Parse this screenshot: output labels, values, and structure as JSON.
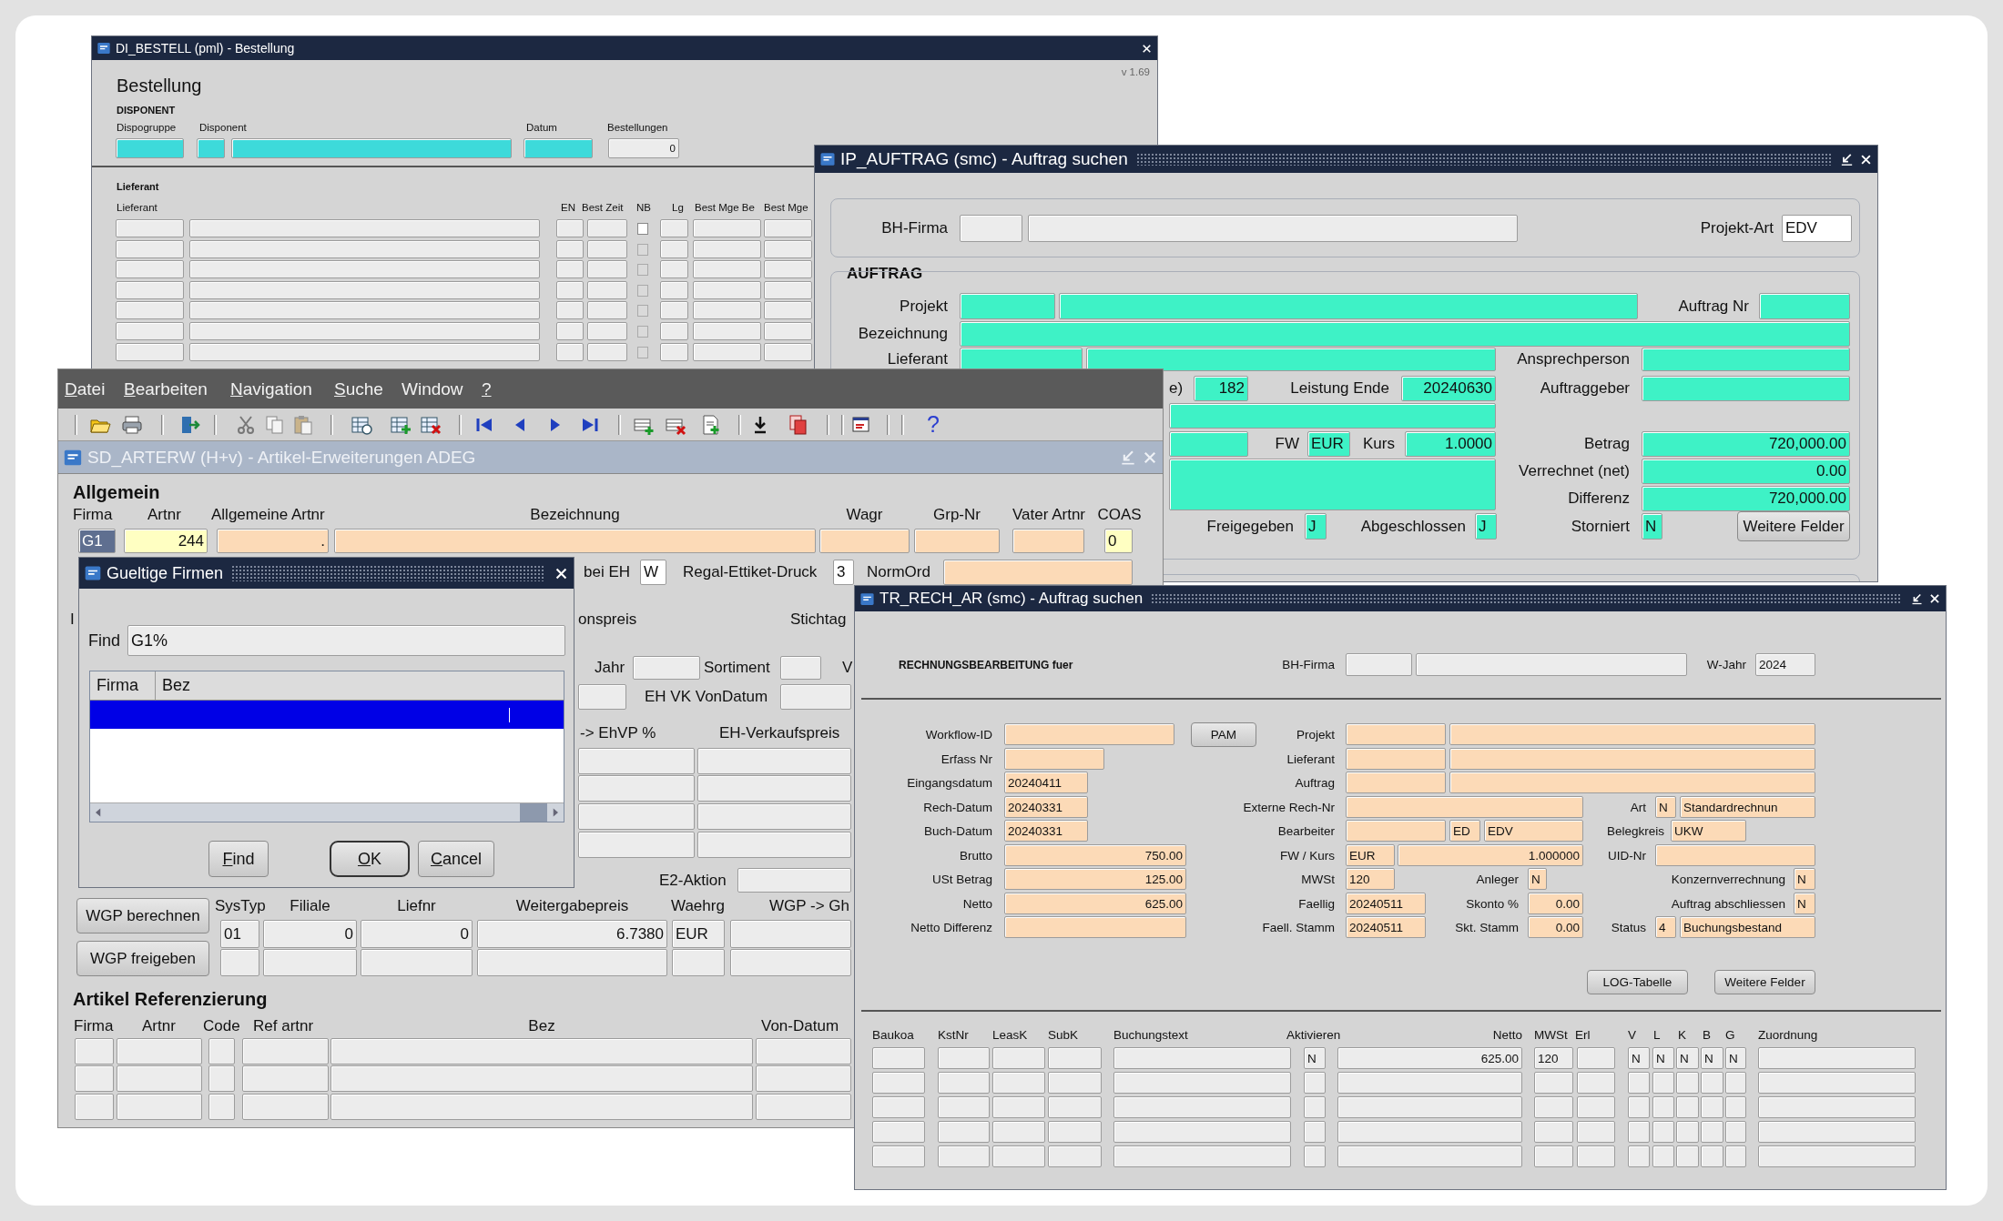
{
  "bestell": {
    "title": "DI_BESTELL (pml) - Bestellung",
    "version": "v 1.69",
    "heading": "Bestellung",
    "disponent": {
      "section": "DISPONENT",
      "labels": [
        "Dispogruppe",
        "Disponent",
        "Datum",
        "Bestellungen"
      ],
      "bestellungen": "0"
    },
    "lieferant": {
      "section": "Lieferant",
      "columns": [
        "Lieferant",
        "EN",
        "Best Zeit",
        "NB",
        "Lg",
        "Best Mge Be",
        "Best Mge"
      ],
      "rows": [
        {
          "checked": false,
          "disabled": false
        },
        {
          "checked": false,
          "disabled": true
        },
        {
          "checked": false,
          "disabled": true
        },
        {
          "checked": false,
          "disabled": true
        },
        {
          "checked": false,
          "disabled": true
        },
        {
          "checked": false,
          "disabled": true
        },
        {
          "checked": false,
          "disabled": true
        }
      ]
    }
  },
  "auftrag": {
    "title": "IP_AUFTRAG (smc) - Auftrag suchen",
    "bh_firma": {
      "label": "BH-Firma"
    },
    "projekt_art": {
      "label": "Projekt-Art",
      "value": "EDV"
    },
    "section": "AUFTRAG",
    "fields": {
      "projekt": {
        "label": "Projekt"
      },
      "auftrag_nr": {
        "label": "Auftrag Nr"
      },
      "bezeichnung": {
        "label": "Bezeichnung"
      },
      "lieferant": {
        "label": "Lieferant"
      },
      "ansprechperson": {
        "label": "Ansprechperson"
      },
      "label_e": {
        "label": "e)",
        "value": "182"
      },
      "leistung_ende": {
        "label": "Leistung Ende",
        "value": "20240630"
      },
      "auftraggeber": {
        "label": "Auftraggeber"
      },
      "fw": {
        "label": "FW",
        "value": "EUR"
      },
      "kurs": {
        "label": "Kurs",
        "value": "1.0000"
      },
      "betrag": {
        "label": "Betrag",
        "value": "720,000.00"
      },
      "verrechnet": {
        "label": "Verrechnet (net)",
        "value": "0.00"
      },
      "differenz": {
        "label": "Differenz",
        "value": "720,000.00"
      },
      "freigegeben": {
        "label": "Freigegeben",
        "value": "J"
      },
      "abgeschlossen": {
        "label": "Abgeschlossen",
        "value": "J"
      },
      "storniert": {
        "label": "Storniert",
        "value": "N"
      }
    },
    "button": "Weitere Felder"
  },
  "artikel": {
    "menu": [
      {
        "label": "Datei",
        "mnemonic": true
      },
      {
        "label": "Bearbeiten",
        "mnemonic": true
      },
      {
        "label": "Navigation",
        "mnemonic": true
      },
      {
        "label": "Suche",
        "mnemonic": true
      },
      {
        "label": "Window",
        "mnemonic": false
      },
      {
        "label": "?",
        "mnemonic": true
      }
    ],
    "help": "?",
    "title": "SD_ARTERW (H+v) - Artikel-Erweiterungen ADEG",
    "section": "Allgemein",
    "columns": [
      "Firma",
      "Artnr",
      "Allgemeine Artnr",
      "Bezeichnung",
      "Wagr",
      "Grp-Nr",
      "Vater Artnr",
      "COAS"
    ],
    "firma": {
      "value": "G1",
      "selected": true
    },
    "artnr": "244",
    "allgemeine_artnr": ".",
    "coas": "0",
    "fields": {
      "bei_eh": {
        "label": "bei EH",
        "value": "W"
      },
      "regal_ettiket_druck": {
        "label": "Regal-Ettiket-Druck",
        "value": "3"
      },
      "normord": {
        "label": "NormOrd"
      },
      "label_i": {
        "label": "I"
      },
      "label_onspreis": {
        "label": "onspreis"
      },
      "stichtag": {
        "label": "Stichtag"
      },
      "jahr": {
        "label": "Jahr"
      },
      "sortiment": {
        "label": "Sortiment"
      },
      "label_v": {
        "label": "V"
      },
      "eh_vk_vondatum": {
        "label": "EH VK VonDatum"
      },
      "ehvp": {
        "label": "-> EhVP %"
      },
      "eh_verkaufspreis": {
        "label": "EH-Verkaufspreis"
      },
      "e2_aktion": {
        "label": "E2-Aktion"
      }
    },
    "wgp_buttons": [
      "WGP berechnen",
      "WGP freigeben"
    ],
    "wgp_columns": [
      "SysTyp",
      "Filiale",
      "Liefnr",
      "Weitergabepreis",
      "Waehrg",
      "WGP -> Gh"
    ],
    "wgp_rows": [
      [
        "01",
        "0",
        "0",
        "6.7380",
        "EUR"
      ]
    ],
    "referenz": {
      "title": "Artikel Referenzierung",
      "columns": [
        "Firma",
        "Artnr",
        "Code",
        "Ref artnr",
        "Bez",
        "Von-Datum"
      ]
    }
  },
  "dialog": {
    "title": "Gueltige Firmen",
    "find_label": "Find",
    "find_value": "G1%",
    "columns": [
      "Firma",
      "Bez"
    ],
    "rows": [
      {
        "selected": true
      }
    ],
    "buttons": [
      {
        "label": "Find",
        "mnemonic": true,
        "default": false
      },
      {
        "label": "OK",
        "mnemonic": true,
        "default": true
      },
      {
        "label": "Cancel",
        "mnemonic": true,
        "default": false
      }
    ]
  },
  "rechnung": {
    "title": "TR_RECH_AR (smc) - Auftrag suchen",
    "heading": "RECHNUNGSBEARBEITUNG fuer",
    "bh_firma_label": "BH-Firma",
    "w_jahr": {
      "label": "W-Jahr",
      "value": "2024"
    },
    "pam": "PAM",
    "fields": {
      "workflow_id": {
        "label": "Workflow-ID"
      },
      "projekt": {
        "label": "Projekt"
      },
      "erfass_nr": {
        "label": "Erfass Nr"
      },
      "lieferant": {
        "label": "Lieferant"
      },
      "eingangsdatum": {
        "label": "Eingangsdatum",
        "value": "20240411"
      },
      "auftrag": {
        "label": "Auftrag"
      },
      "rech_datum": {
        "label": "Rech-Datum",
        "value": "20240331"
      },
      "externe_rech_nr": {
        "label": "Externe Rech-Nr"
      },
      "art": {
        "label": "Art",
        "value": "N",
        "value_2": "Standardrechnun"
      },
      "buch_datum": {
        "label": "Buch-Datum",
        "value": "20240331"
      },
      "bearbeiter": {
        "label": "Bearbeiter",
        "value_2": "ED",
        "value_3": "EDV"
      },
      "belegkreis": {
        "label": "Belegkreis",
        "value": "UKW"
      },
      "brutto": {
        "label": "Brutto",
        "value": "750.00"
      },
      "fw_kurs": {
        "label": "FW / Kurs",
        "value": "EUR",
        "value_2": "1.000000"
      },
      "uid_nr": {
        "label": "UID-Nr"
      },
      "ust_betrag": {
        "label": "USt Betrag",
        "value": "125.00"
      },
      "mwst": {
        "label": "MWSt",
        "value": "120"
      },
      "anleger": {
        "label": "Anleger",
        "value": "N"
      },
      "konzernverrechnung": {
        "label": "Konzernverrechnung",
        "value": "N"
      },
      "netto": {
        "label": "Netto",
        "value": "625.00"
      },
      "faellig": {
        "label": "Faellig",
        "value": "20240511"
      },
      "skonto": {
        "label": "Skonto %",
        "value": "0.00"
      },
      "auftrag_abschliessen": {
        "label": "Auftrag abschliessen",
        "value": "N"
      },
      "netto_differenz": {
        "label": "Netto Differenz"
      },
      "faell_stamm": {
        "label": "Faell. Stamm",
        "value": "20240511"
      },
      "skt_stamm": {
        "label": "Skt. Stamm",
        "value": "0.00"
      },
      "status": {
        "label": "Status",
        "value": "4",
        "value_2": "Buchungsbestand"
      }
    },
    "buttons": [
      "LOG-Tabelle",
      "Weitere Felder"
    ],
    "columns": [
      "Baukoa",
      "KstNr",
      "LeasK",
      "SubK",
      "Buchungstext",
      "Aktivieren",
      "Netto",
      "MWSt",
      "Erl",
      "V",
      "L",
      "K",
      "B",
      "G",
      "Zuordnung"
    ],
    "rows": [
      {
        "aktivieren": "N",
        "netto": "625.00",
        "mwst": "120",
        "v": "N",
        "l": "N",
        "k": "N",
        "b": "N",
        "g": "N"
      }
    ]
  }
}
